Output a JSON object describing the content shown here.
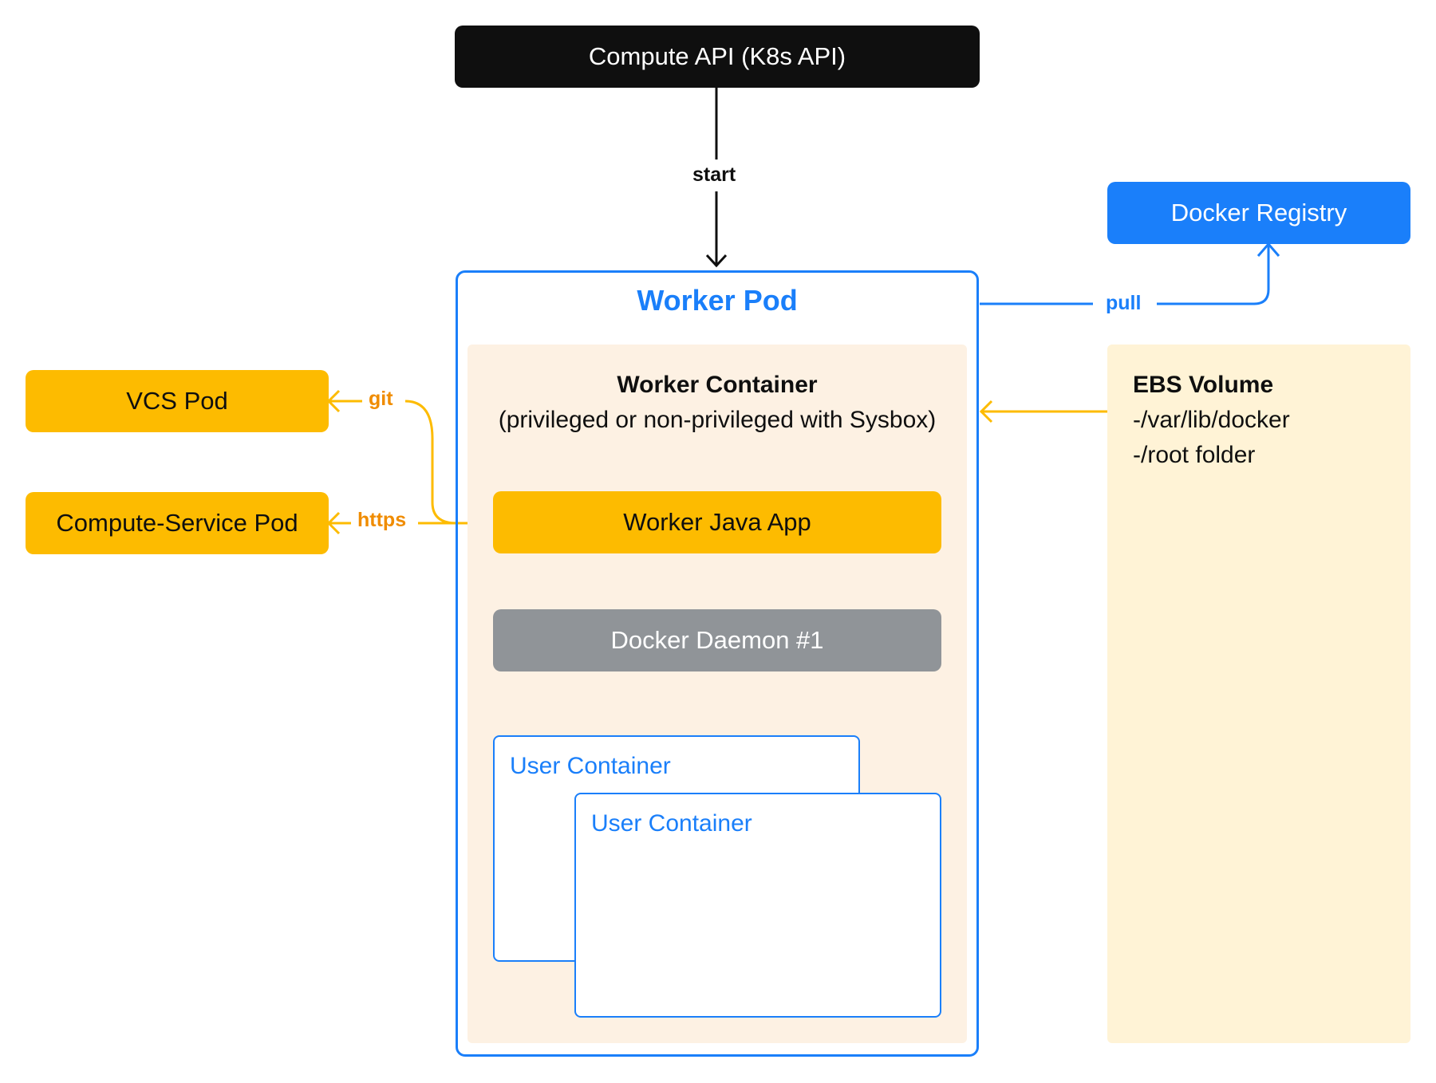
{
  "nodes": {
    "compute_api": "Compute API (K8s API)",
    "docker_registry": "Docker Registry",
    "worker_pod": "Worker Pod",
    "worker_container_title": "Worker Container",
    "worker_container_subtitle": "(privileged or non-privileged with Sysbox)",
    "vcs_pod": "VCS Pod",
    "compute_service_pod": "Compute-Service Pod",
    "worker_java_app": "Worker Java App",
    "docker_daemon": "Docker Daemon #1",
    "user_container_1": "User Container",
    "user_container_2": "User Container",
    "ebs_title": "EBS Volume",
    "ebs_lines": [
      "-/var/lib/docker",
      "-/root folder"
    ]
  },
  "edges": {
    "start": "start",
    "pull": "pull",
    "git": "git",
    "https": "https"
  },
  "colors": {
    "black": "#0f0f0f",
    "blue": "#1a7ffa",
    "yellow": "#fdbb00",
    "orange_label": "#f08c00",
    "gray": "#909498",
    "cream": "#fdf1e3",
    "ebs_cream": "#fff3d6"
  }
}
